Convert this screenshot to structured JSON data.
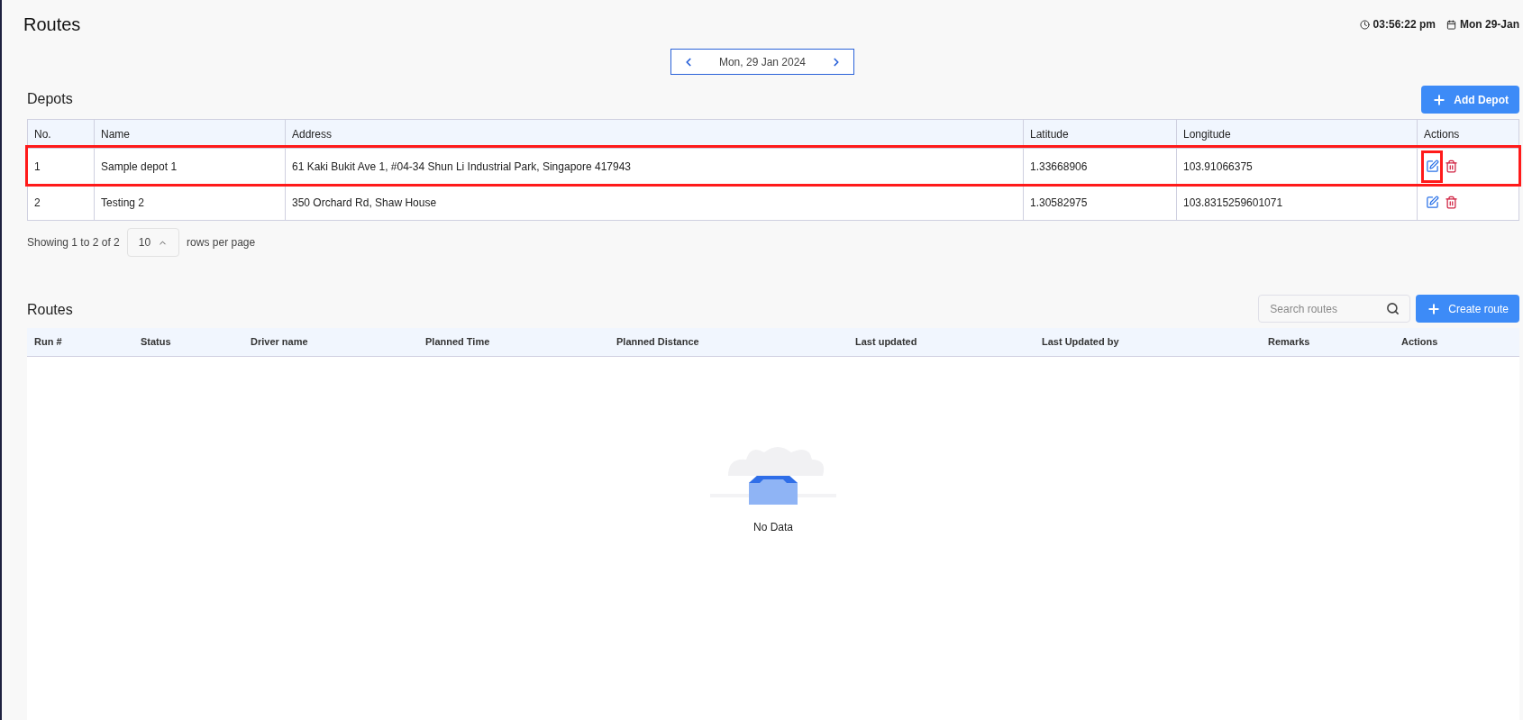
{
  "page": {
    "title": "Routes",
    "time": "03:56:22 pm",
    "date": "Mon 29-Jan"
  },
  "date_nav": {
    "label": "Mon, 29 Jan 2024"
  },
  "depots": {
    "title": "Depots",
    "add_button": "Add Depot",
    "columns": [
      "No.",
      "Name",
      "Address",
      "Latitude",
      "Longitude",
      "Actions"
    ],
    "rows": [
      {
        "cells": [
          "1",
          "Sample depot 1",
          "61 Kaki Bukit Ave 1, #04-34 Shun Li Industrial Park, Singapore 417943",
          "1.33668906",
          "103.91066375"
        ],
        "highlighted": true,
        "edit_highlighted": true
      },
      {
        "cells": [
          "2",
          "Testing 2",
          "350 Orchard Rd, Shaw House",
          "1.30582975",
          "103.8315259601071"
        ],
        "highlighted": false,
        "edit_highlighted": false
      }
    ],
    "pagination": {
      "summary": "Showing 1 to 2 of 2",
      "page_size": "10",
      "suffix": "rows per page"
    }
  },
  "routes": {
    "title": "Routes",
    "search": {
      "placeholder": "Search routes"
    },
    "create_button": "Create route",
    "columns": [
      "Run #",
      "Status",
      "Driver name",
      "Planned Time",
      "Planned Distance",
      "Last updated",
      "Last Updated by",
      "Remarks",
      "Actions"
    ],
    "empty_text": "No Data"
  }
}
